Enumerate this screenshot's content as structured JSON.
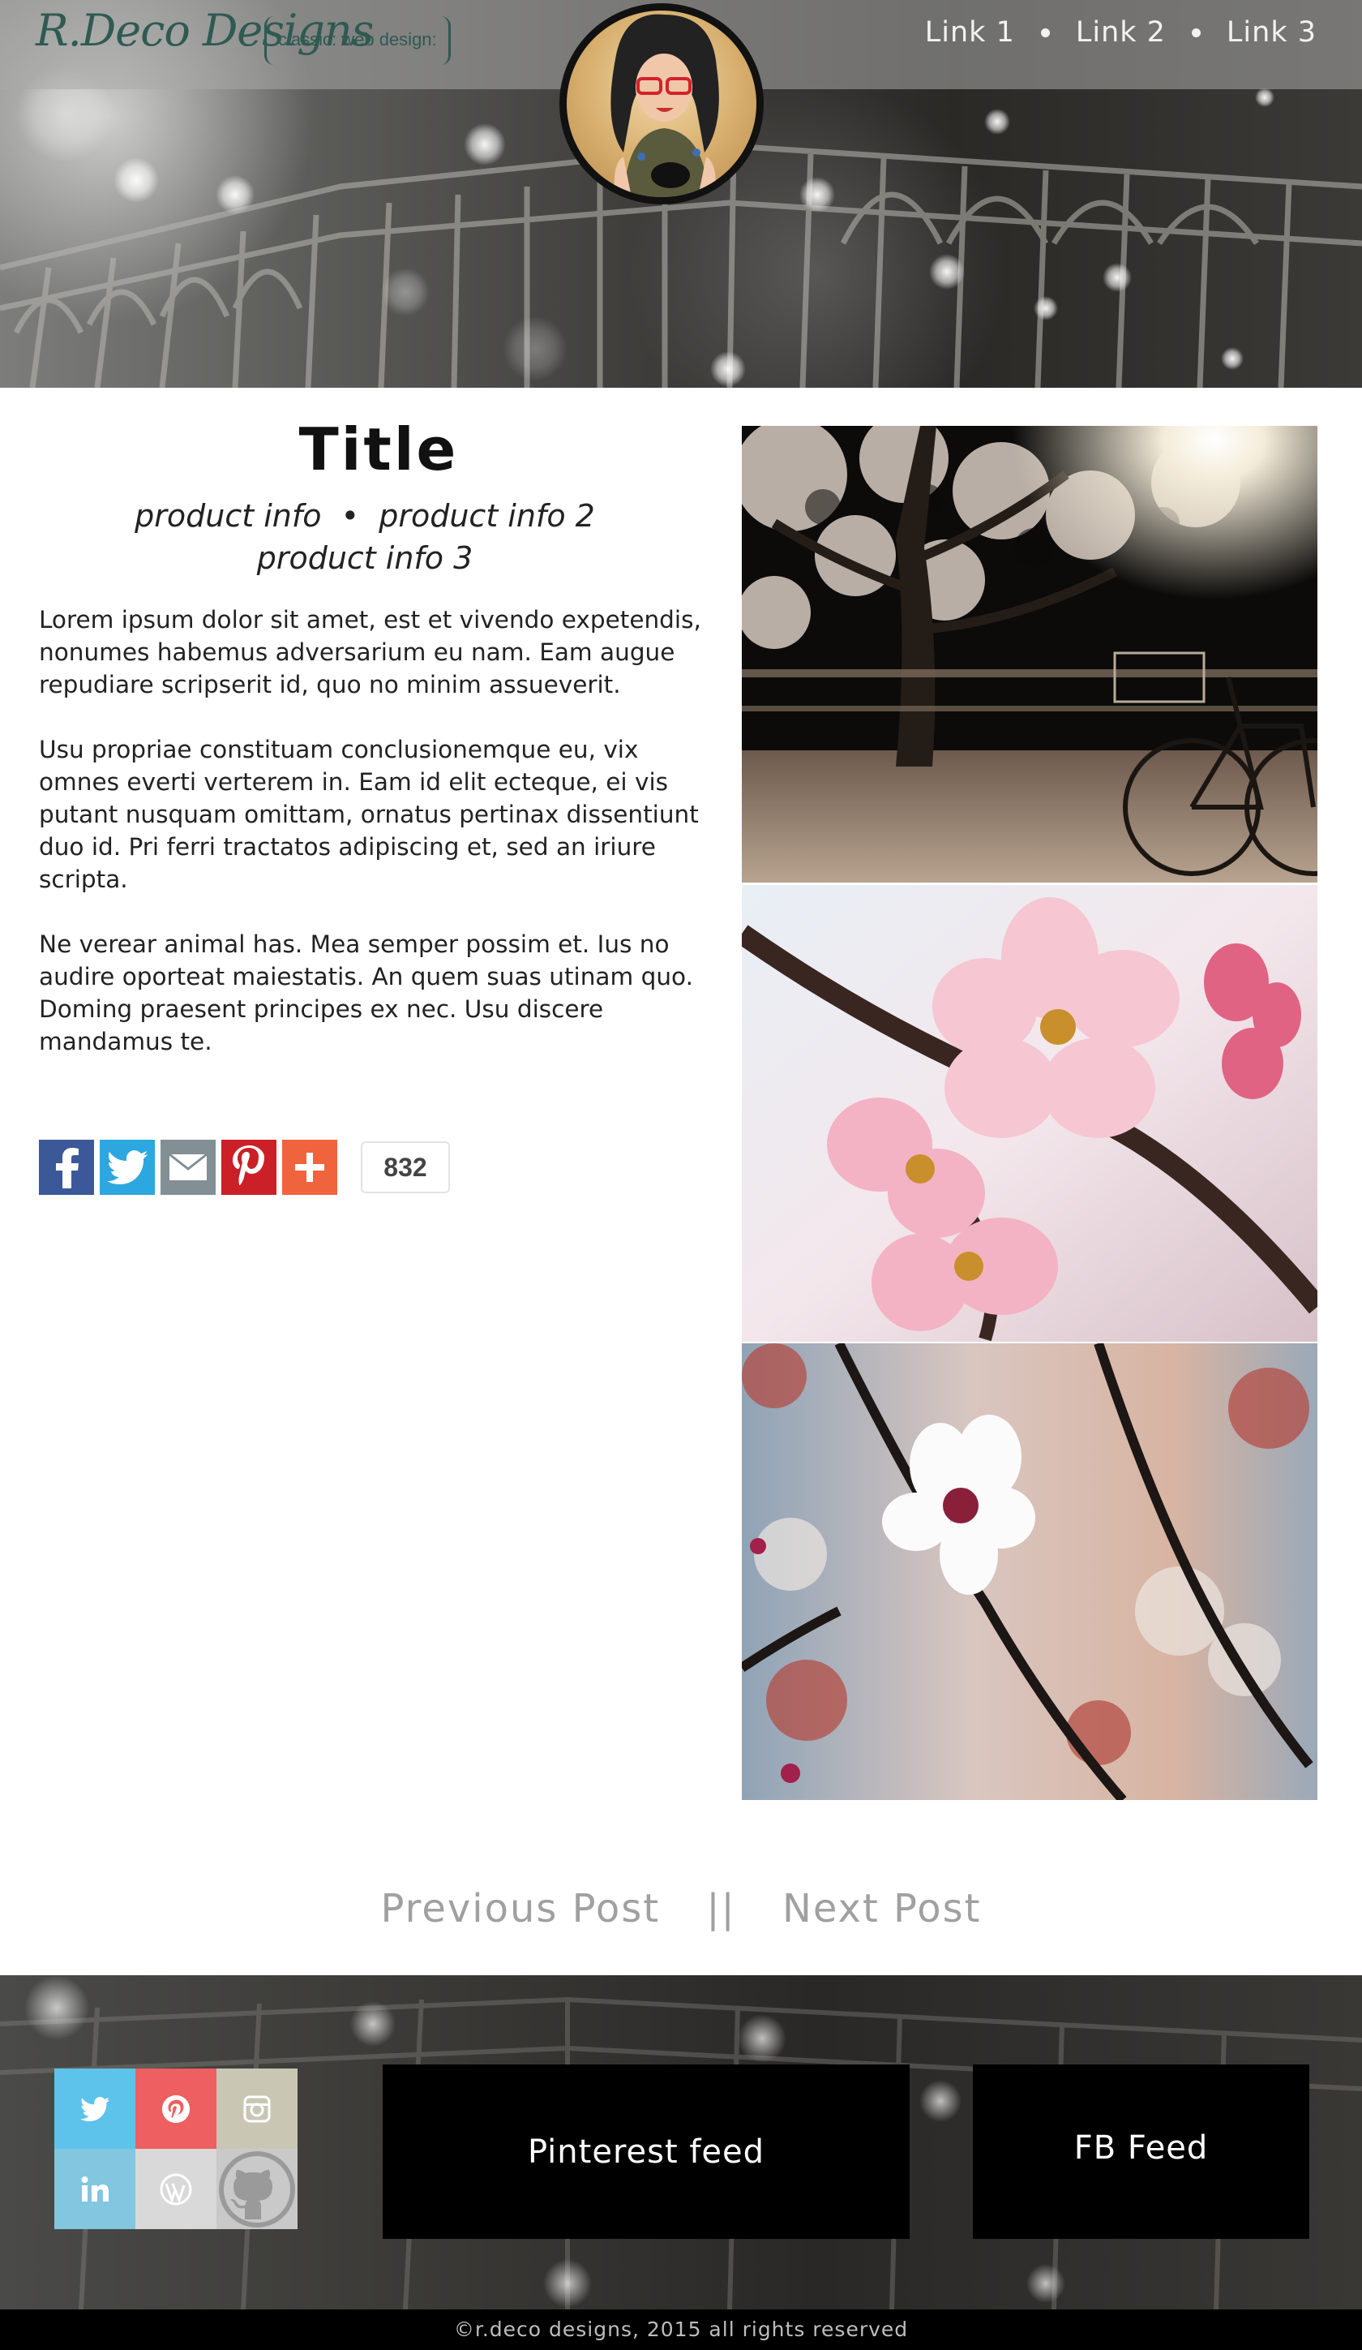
{
  "header": {
    "logo": "R.Deco Designs",
    "tagline": "classic: web design:",
    "nav": [
      {
        "label": "Link 1"
      },
      {
        "label": "Link 2"
      },
      {
        "label": "Link 3"
      }
    ]
  },
  "post": {
    "title": "Title",
    "meta_line1": "product info  •  product info 2",
    "meta_line2": "product info 3",
    "paragraphs": [
      "Lorem ipsum dolor sit amet, est et vivendo expetendis, nonumes habemus adversarium eu nam. Eam augue repudiare scripserit id, quo no minim assueverit.",
      "Usu propriae constituam conclusionemque eu, vix omnes everti verterem in. Eam id elit ecteque, ei vis putant nusquam omittam, ornatus pertinax dissentiunt duo id. Pri ferri tractatos adipiscing et, sed an iriure scripta.",
      "Ne verear animal has. Mea semper possim et. Ius no audire oporteat maiestatis. An quem suas utinam quo. Doming praesent principes ex nec. Usu discere mandamus te."
    ],
    "share": {
      "buttons": [
        {
          "icon": "facebook-icon",
          "color": "#3b5998"
        },
        {
          "icon": "twitter-icon",
          "color": "#2ca7e0"
        },
        {
          "icon": "email-icon",
          "color": "#828f94"
        },
        {
          "icon": "pinterest-icon",
          "color": "#cb2027"
        },
        {
          "icon": "plus-icon",
          "color": "#f0643d"
        }
      ],
      "count": "832"
    }
  },
  "post_nav": {
    "previous": "Previous Post",
    "separator": "||",
    "next": "Next Post"
  },
  "footer": {
    "social": [
      {
        "icon": "twitter-icon",
        "color": "#5ec3ea"
      },
      {
        "icon": "pinterest-icon",
        "color": "#ee5f61"
      },
      {
        "icon": "instagram-icon",
        "color": "#c9c7b4"
      },
      {
        "icon": "linkedin-icon",
        "color": "#82c6e0"
      },
      {
        "icon": "wordpress-icon",
        "color": "#d9d9d9"
      },
      {
        "icon": "github-icon",
        "color": "#c9c9c9"
      }
    ],
    "pinterest_feed": "Pinterest feed",
    "fb_feed": "FB Feed",
    "copyright": "©r.deco designs, 2015 all rights reserved"
  }
}
